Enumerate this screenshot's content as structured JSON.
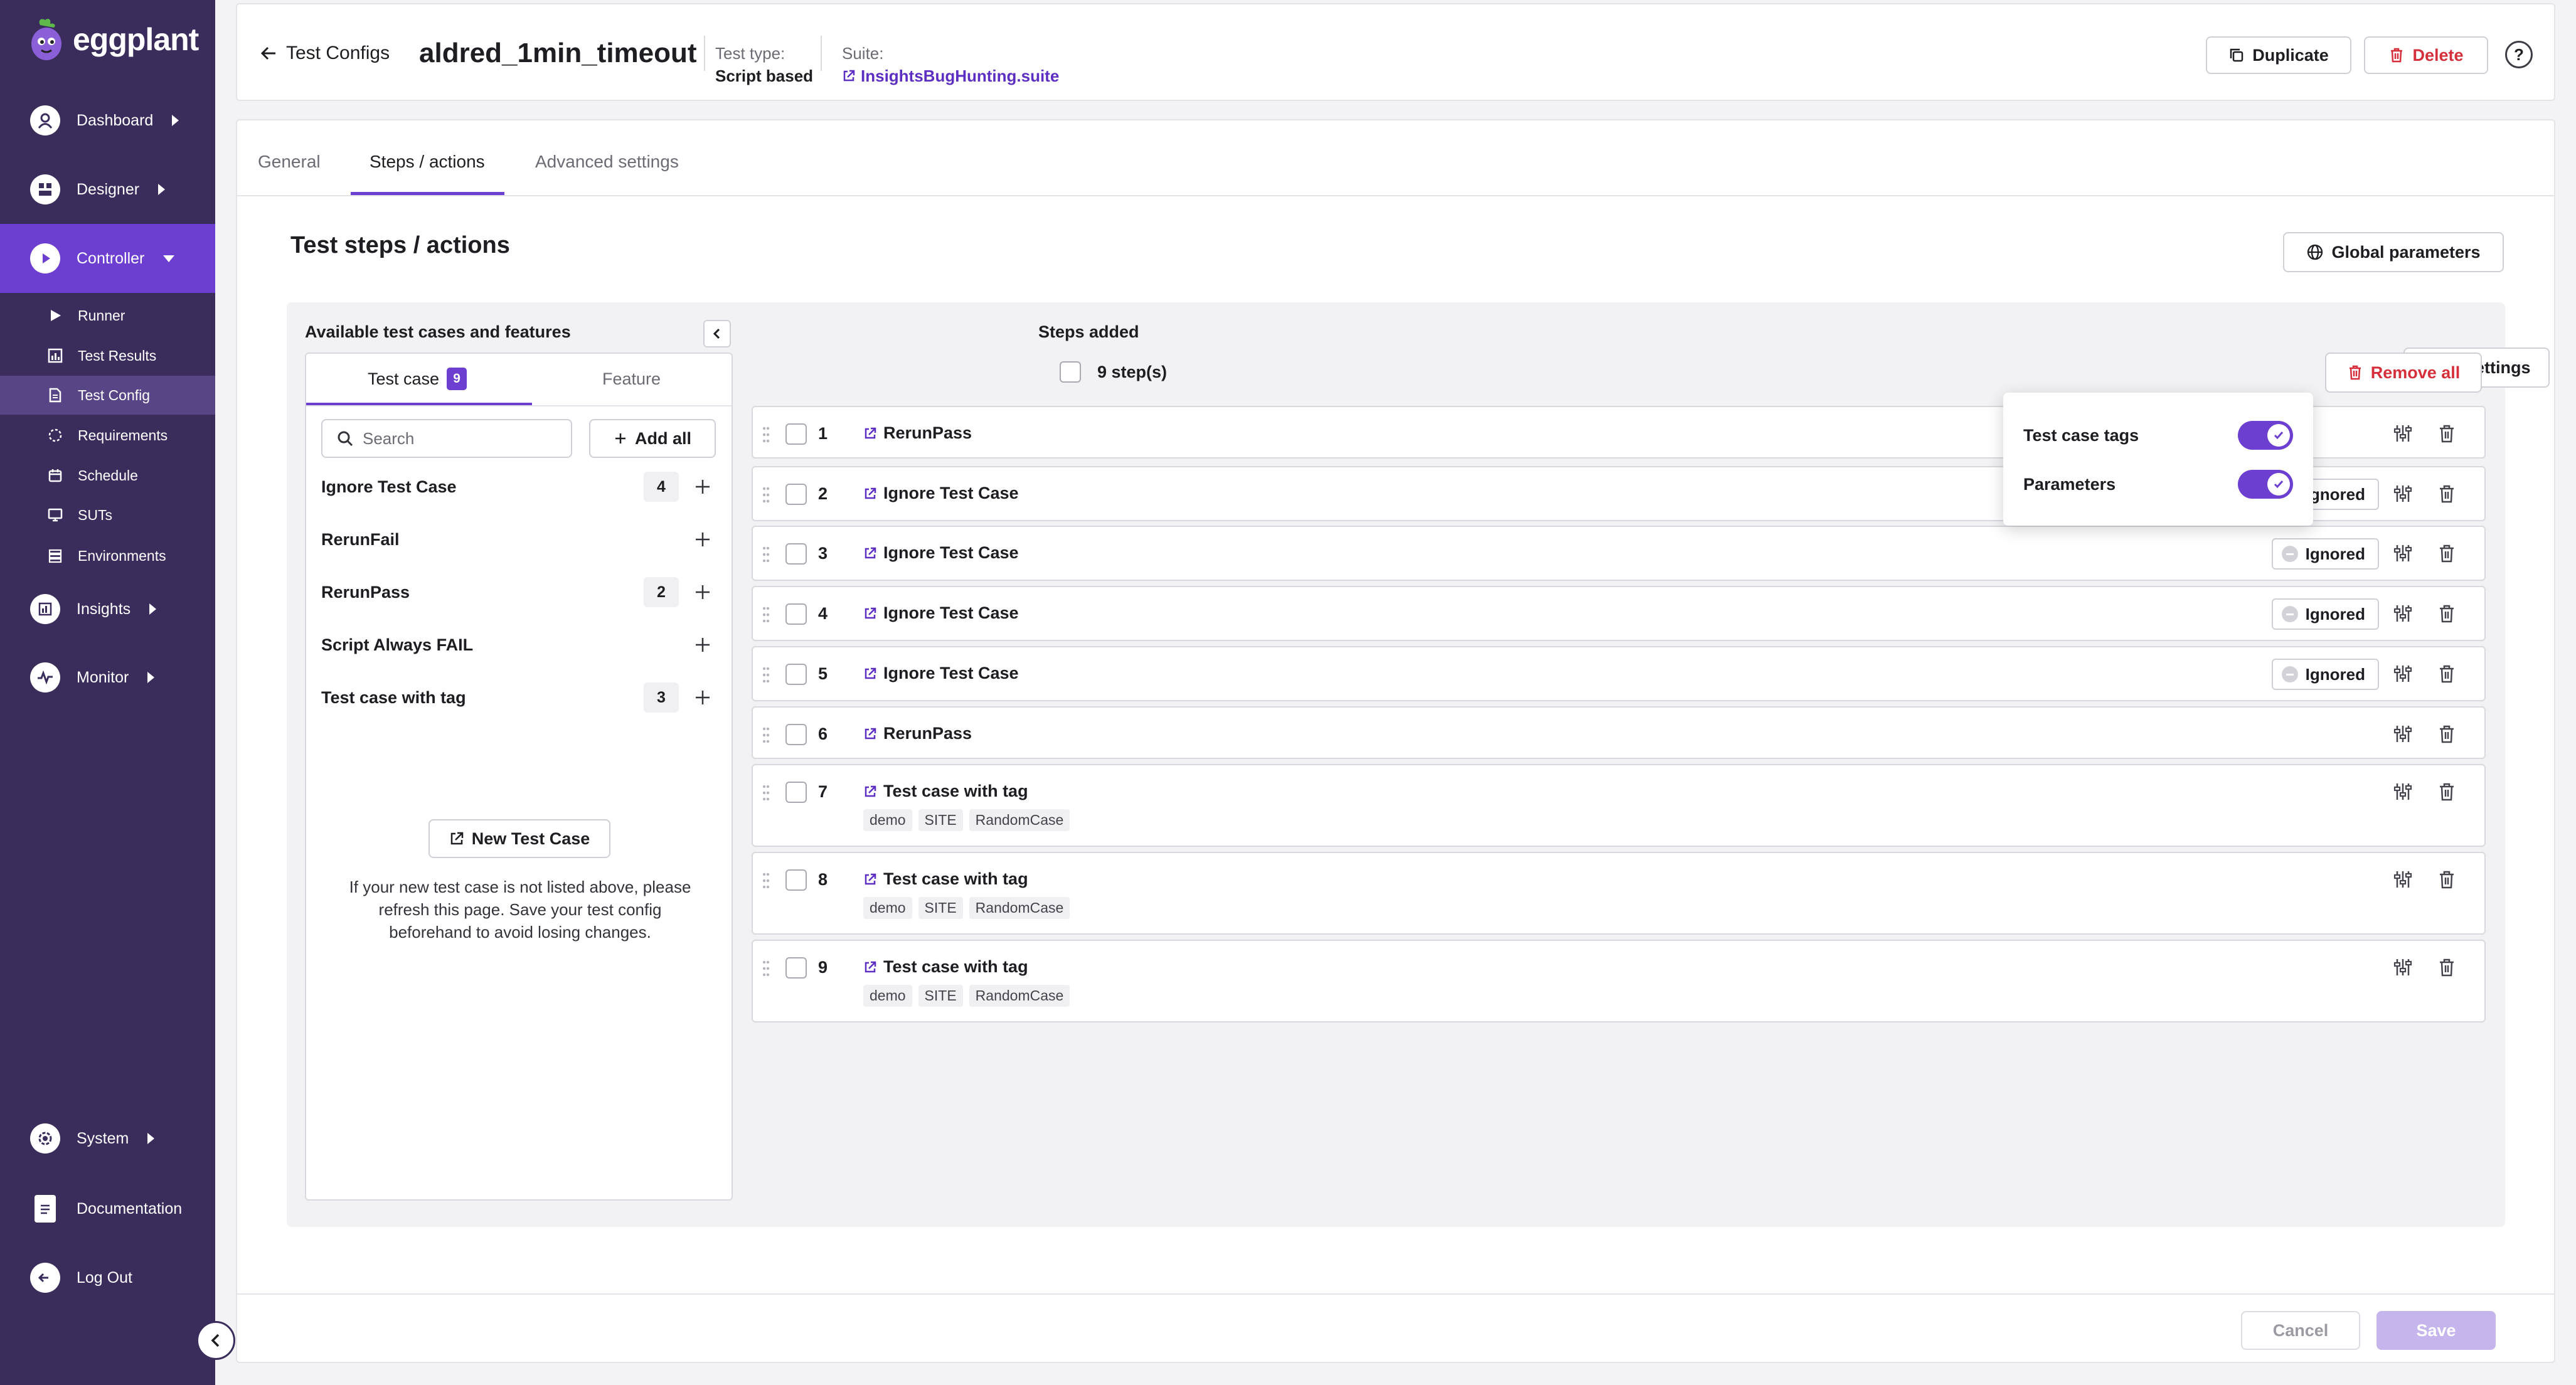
{
  "brand": {
    "name": "eggplant"
  },
  "sidebar": {
    "main": [
      {
        "label": "Dashboard",
        "icon": "user-circle-icon"
      },
      {
        "label": "Designer",
        "icon": "designer-icon"
      },
      {
        "label": "Controller",
        "icon": "play-circle-icon",
        "active": true
      }
    ],
    "sub": [
      {
        "label": "Runner",
        "icon": "play-icon"
      },
      {
        "label": "Test Results",
        "icon": "bar-chart-icon"
      },
      {
        "label": "Test Config",
        "icon": "document-icon",
        "active": true
      },
      {
        "label": "Requirements",
        "icon": "requirements-icon"
      },
      {
        "label": "Schedule",
        "icon": "calendar-icon"
      },
      {
        "label": "SUTs",
        "icon": "monitor-icon"
      },
      {
        "label": "Environments",
        "icon": "layers-icon"
      }
    ],
    "lower": [
      {
        "label": "Insights",
        "icon": "insights-icon"
      },
      {
        "label": "Monitor",
        "icon": "monitor-pulse-icon"
      }
    ],
    "bottom": [
      {
        "label": "System",
        "icon": "gear-icon"
      },
      {
        "label": "Documentation",
        "icon": "documentation-icon"
      },
      {
        "label": "Log Out",
        "icon": "logout-icon"
      }
    ]
  },
  "header": {
    "back_label": "Test Configs",
    "title": "aldred_1min_timeout",
    "test_type_label": "Test type:",
    "test_type_value": "Script based",
    "suite_label": "Suite:",
    "suite_value": "InsightsBugHunting.suite",
    "duplicate_label": "Duplicate",
    "delete_label": "Delete",
    "help_glyph": "?"
  },
  "tabs": [
    {
      "label": "General"
    },
    {
      "label": "Steps / actions",
      "active": true
    },
    {
      "label": "Advanced settings"
    }
  ],
  "section": {
    "title": "Test steps / actions",
    "global_params_label": "Global parameters"
  },
  "left_panel": {
    "title": "Available test cases and features",
    "tab_test_case": "Test case",
    "tab_test_case_count": "9",
    "tab_feature": "Feature",
    "search_placeholder": "Search",
    "add_all_label": "Add all",
    "test_cases": [
      {
        "name": "Ignore Test Case",
        "count": "4"
      },
      {
        "name": "RerunFail",
        "count": ""
      },
      {
        "name": "RerunPass",
        "count": "2"
      },
      {
        "name": "Script Always FAIL",
        "count": ""
      },
      {
        "name": "Test case with tag",
        "count": "3"
      }
    ],
    "new_test_case_label": "New Test Case",
    "help_text_lines": [
      "If your new test case is not listed above, please",
      "refresh this page. Save your test config",
      "beforehand to avoid losing changes."
    ]
  },
  "steps": {
    "title": "Steps added",
    "count_label": "9 step(s)",
    "view_settings_label": "View settings",
    "remove_all_label": "Remove all",
    "ignored_label": "Ignored",
    "rows": [
      {
        "num": "1",
        "name": "RerunPass",
        "ignored": false,
        "tags": []
      },
      {
        "num": "2",
        "name": "Ignore Test Case",
        "ignored": true,
        "tags": []
      },
      {
        "num": "3",
        "name": "Ignore Test Case",
        "ignored": true,
        "tags": []
      },
      {
        "num": "4",
        "name": "Ignore Test Case",
        "ignored": true,
        "tags": []
      },
      {
        "num": "5",
        "name": "Ignore Test Case",
        "ignored": true,
        "tags": []
      },
      {
        "num": "6",
        "name": "RerunPass",
        "ignored": false,
        "tags": []
      },
      {
        "num": "7",
        "name": "Test case with tag",
        "ignored": false,
        "tags": [
          "demo",
          "SITE",
          "RandomCase"
        ]
      },
      {
        "num": "8",
        "name": "Test case with tag",
        "ignored": false,
        "tags": [
          "demo",
          "SITE",
          "RandomCase"
        ]
      },
      {
        "num": "9",
        "name": "Test case with tag",
        "ignored": false,
        "tags": [
          "demo",
          "SITE",
          "RandomCase"
        ]
      }
    ]
  },
  "view_settings_popover": {
    "options": [
      {
        "label": "Test case tags",
        "enabled": true
      },
      {
        "label": "Parameters",
        "enabled": true
      }
    ]
  },
  "footer": {
    "cancel_label": "Cancel",
    "save_label": "Save"
  },
  "colors": {
    "sidebar_bg": "#3a2d5c",
    "accent": "#6d3fd0",
    "danger": "#d42f3a",
    "link": "#5c2fc2"
  }
}
